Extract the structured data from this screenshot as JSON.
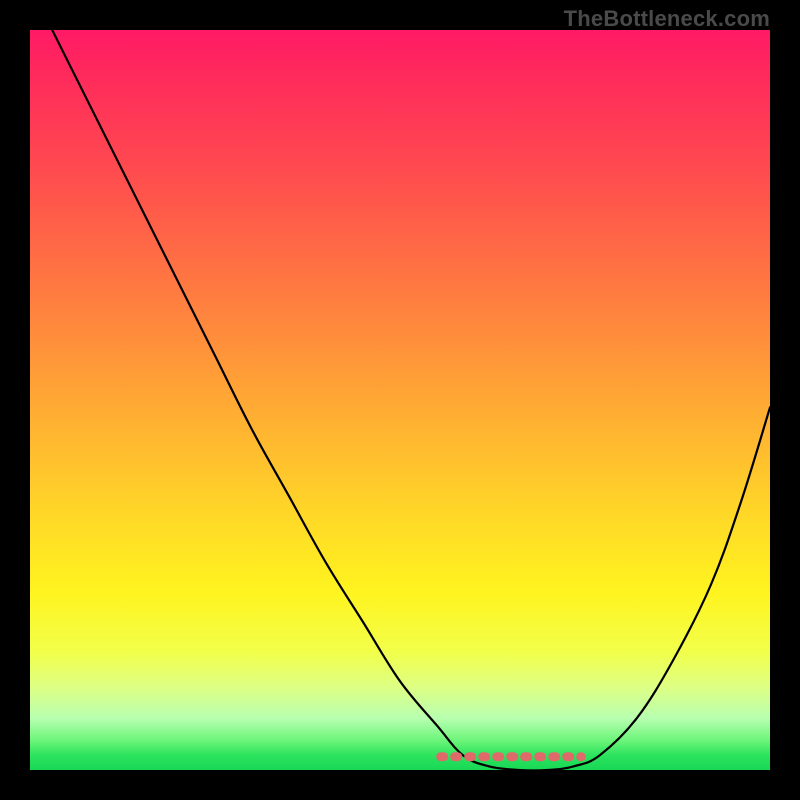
{
  "watermark": "TheBottleneck.com",
  "colors": {
    "frame": "#000000",
    "curve_stroke": "#000000",
    "dash_stroke": "#e06a6a",
    "gradient_stops": [
      "#ff1a66",
      "#ff4850",
      "#ff8f3b",
      "#ffd927",
      "#f2ff4a",
      "#6cf57a",
      "#17d856"
    ]
  },
  "chart_data": {
    "type": "line",
    "title": "",
    "xlabel": "",
    "ylabel": "",
    "xlim": [
      0,
      1
    ],
    "ylim": [
      0,
      1
    ],
    "grid": false,
    "series": [
      {
        "name": "curve",
        "x": [
          0.0,
          0.05,
          0.1,
          0.15,
          0.2,
          0.25,
          0.3,
          0.35,
          0.4,
          0.45,
          0.5,
          0.55,
          0.585,
          0.62,
          0.66,
          0.7,
          0.735,
          0.77,
          0.82,
          0.87,
          0.92,
          0.96,
          1.0
        ],
        "y": [
          1.06,
          0.96,
          0.86,
          0.76,
          0.66,
          0.56,
          0.46,
          0.37,
          0.28,
          0.2,
          0.12,
          0.06,
          0.02,
          0.005,
          0.0,
          0.0,
          0.005,
          0.02,
          0.07,
          0.15,
          0.25,
          0.36,
          0.49
        ]
      }
    ],
    "annotations": [
      {
        "name": "bottom-dash",
        "style": "dashed",
        "color": "#e06a6a",
        "x": [
          0.555,
          0.745
        ],
        "y": [
          0.018,
          0.018
        ]
      }
    ]
  }
}
